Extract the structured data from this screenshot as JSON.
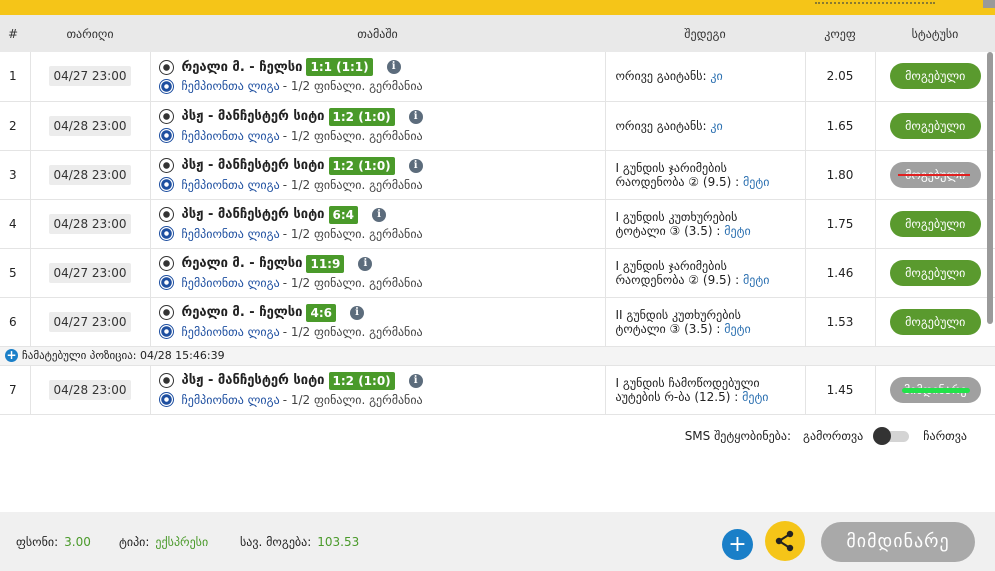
{
  "header": {
    "col_num": "#",
    "col_date": "თარიღი",
    "col_game": "თამაში",
    "col_result": "შედეგი",
    "col_odd": "კოეფ",
    "col_status": "სტატუსი"
  },
  "rows": [
    {
      "num": "1",
      "date": "04/27 23:00",
      "teams": "რეალი მ. - ჩელსი",
      "score": "1:1 (1:1)",
      "league": "ჩემპიონთა ლიგა",
      "stage": " - 1/2 ფინალი. გერმანია",
      "result_line1": "ორივე გაიტანს: ",
      "result_val": "კი",
      "result_line2": "",
      "odd": "2.05",
      "status": "მოგებული"
    },
    {
      "num": "2",
      "date": "04/28 23:00",
      "teams": "პსჟ - მანჩესტერ სიტი",
      "score": "1:2 (1:0)",
      "league": "ჩემპიონთა ლიგა",
      "stage": " - 1/2 ფინალი. გერმანია",
      "result_line1": "ორივე გაიტანს: ",
      "result_val": "კი",
      "result_line2": "",
      "odd": "1.65",
      "status": "მოგებული"
    },
    {
      "num": "3",
      "date": "04/28 23:00",
      "teams": "პსჟ - მანჩესტერ სიტი",
      "score": "1:2 (1:0)",
      "league": "ჩემპიონთა ლიგა",
      "stage": " - 1/2 ფინალი. გერმანია",
      "result_line1": "I გუნდის ჯარიმების",
      "result_line2": "რაოდენობა ② (9.5) : ",
      "result_val": "მეტი",
      "odd": "1.80",
      "status": "მოგებული"
    },
    {
      "num": "4",
      "date": "04/28 23:00",
      "teams": "პსჟ - მანჩესტერ სიტი",
      "score": "6:4",
      "league": "ჩემპიონთა ლიგა",
      "stage": " - 1/2 ფინალი. გერმანია",
      "result_line1": "I გუნდის კუთხურების",
      "result_line2": "ტოტალი ③ (3.5) : ",
      "result_val": "მეტი",
      "odd": "1.75",
      "status": "მოგებული"
    },
    {
      "num": "5",
      "date": "04/27 23:00",
      "teams": "რეალი მ. - ჩელსი",
      "score": "11:9",
      "league": "ჩემპიონთა ლიგა",
      "stage": " - 1/2 ფინალი. გერმანია",
      "result_line1": "I გუნდის ჯარიმების",
      "result_line2": "რაოდენობა ② (9.5) : ",
      "result_val": "მეტი",
      "odd": "1.46",
      "status": "მოგებული"
    },
    {
      "num": "6",
      "date": "04/27 23:00",
      "teams": "რეალი მ. - ჩელსი",
      "score": "4:6",
      "league": "ჩემპიონთა ლიგა",
      "stage": " - 1/2 ფინალი. გერმანია",
      "result_line1": "II გუნდის კუთხურების",
      "result_line2": "ტოტალი ③ (3.5) : ",
      "result_val": "მეტი",
      "odd": "1.53",
      "status": "მოგებული"
    }
  ],
  "changed_notice": "ჩამატებული პოზიცია: 04/28 15:46:39",
  "extra_row": {
    "num": "7",
    "date": "04/28 23:00",
    "teams": "პსჟ - მანჩესტერ სიტი",
    "score": "1:2 (1:0)",
    "league": "ჩემპიონთა ლიგა",
    "stage": " - 1/2 ფინალი. გერმანია",
    "result_line1": "I გუნდის ჩამოწოდებული",
    "result_line2": "აუტების რ-ბა (12.5) : ",
    "result_val": "მეტი",
    "odd": "1.45",
    "status": "მიმდინარე"
  },
  "sms": {
    "label": "SMS შეტყობინება:",
    "off": "გამორთვა",
    "on": "ჩართვა"
  },
  "footer": {
    "bonus_label": "ფსონი:",
    "bonus_value": "3.00",
    "type_label": "ტიპი:",
    "type_value": "ექსპრესი",
    "win_label": "სავ. მოგება:",
    "win_value": "103.53",
    "current_button": "მიმდინარე"
  },
  "colors": {
    "accent": "#f5c518",
    "win": "#5a9a2e",
    "link": "#1e4fa0",
    "plus": "#1a7fc8"
  }
}
